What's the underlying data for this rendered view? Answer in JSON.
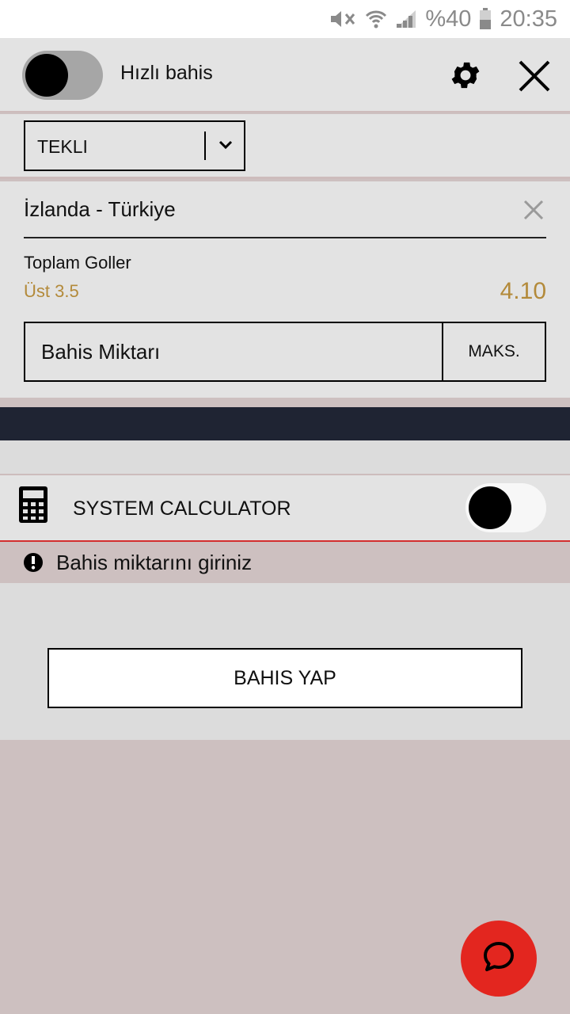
{
  "status_bar": {
    "battery_percent": "%40",
    "time": "20:35",
    "icons": [
      "mute-icon",
      "wifi-icon",
      "signal-icon",
      "battery-icon"
    ]
  },
  "header": {
    "quick_bet_label": "Hızlı bahis",
    "quick_bet_enabled": true,
    "settings_icon": "gear-icon",
    "close_icon": "close-icon"
  },
  "bet_type": {
    "selected": "TEKLI"
  },
  "bet_slip": {
    "match": "İzlanda - Türkiye",
    "market": "Toplam Goller",
    "selection": "Üst 3.5",
    "odds": "4.10",
    "stake_placeholder": "Bahis Miktarı",
    "max_label": "MAKS."
  },
  "system_calculator": {
    "label": "SYSTEM CALCULATOR",
    "enabled": false
  },
  "warning": {
    "text": "Bahis miktarını giriniz"
  },
  "place_bet_label": "BAHIS YAP",
  "colors": {
    "accent_gold": "#b38a3a",
    "error_red": "#d32f2f",
    "chat_red": "#e3261f",
    "dark_bar": "#1f2433"
  }
}
